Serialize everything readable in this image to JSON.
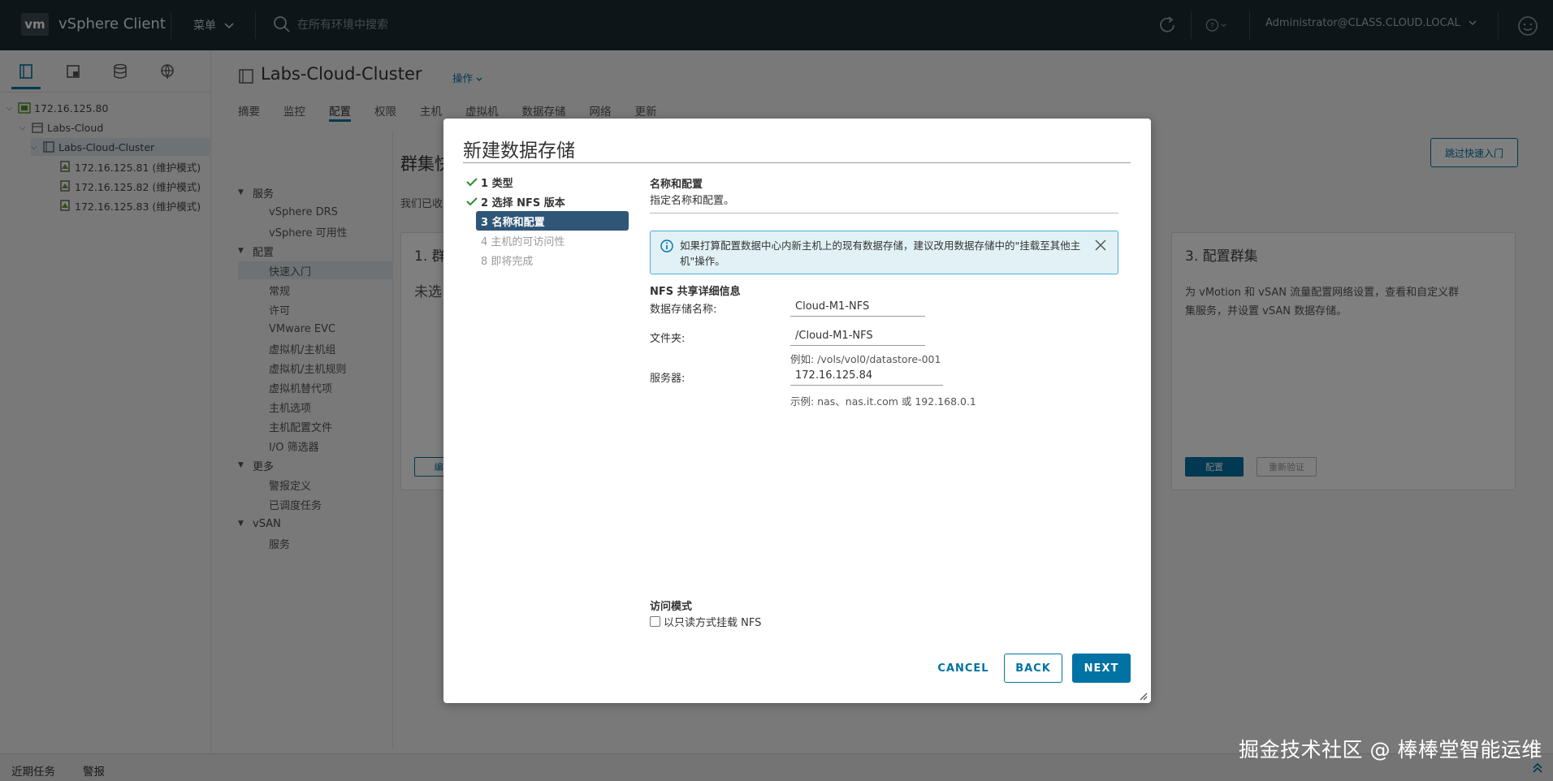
{
  "header": {
    "logo": "vm",
    "app_title": "vSphere Client",
    "menu_label": "菜单",
    "search_placeholder": "在所有环境中搜索",
    "user": "Administrator@CLASS.CLOUD.LOCAL"
  },
  "navigator": {
    "tree": [
      {
        "label": "172.16.125.80",
        "level": 0,
        "expanded": true,
        "icon": "vcenter-icon"
      },
      {
        "label": "Labs-Cloud",
        "level": 1,
        "expanded": true,
        "icon": "datacenter-icon"
      },
      {
        "label": "Labs-Cloud-Cluster",
        "level": 2,
        "expanded": true,
        "icon": "cluster-icon",
        "selected": true
      },
      {
        "label": "172.16.125.81 (维护模式)",
        "level": 3,
        "icon": "host-maintenance-icon"
      },
      {
        "label": "172.16.125.82 (维护模式)",
        "level": 3,
        "icon": "host-maintenance-icon"
      },
      {
        "label": "172.16.125.83 (维护模式)",
        "level": 3,
        "icon": "host-maintenance-icon"
      }
    ]
  },
  "main": {
    "object_title": "Labs-Cloud-Cluster",
    "actions_label": "操作",
    "tabs": [
      "摘要",
      "监控",
      "配置",
      "权限",
      "主机",
      "虚拟机",
      "数据存储",
      "网络",
      "更新"
    ],
    "active_tab": "配置",
    "section_menu": [
      {
        "label": "服务",
        "group": true
      },
      {
        "label": "vSphere DRS"
      },
      {
        "label": "vSphere 可用性"
      },
      {
        "label": "配置",
        "group": true
      },
      {
        "label": "快速入门",
        "selected": true
      },
      {
        "label": "常规"
      },
      {
        "label": "许可"
      },
      {
        "label": "VMware EVC"
      },
      {
        "label": "虚拟机/主机组"
      },
      {
        "label": "虚拟机/主机规则"
      },
      {
        "label": "虚拟机替代项"
      },
      {
        "label": "主机选项"
      },
      {
        "label": "主机配置文件"
      },
      {
        "label": "I/O 筛选器"
      },
      {
        "label": "更多",
        "group": true
      },
      {
        "label": "警报定义"
      },
      {
        "label": "已调度任务"
      },
      {
        "label": "vSAN",
        "group": true
      },
      {
        "label": "服务"
      }
    ],
    "background_heading": "群集快",
    "background_sub": "我们已收",
    "skip_button": "跳过快速入门",
    "card1_title": "1. 群",
    "card1_text": "未选",
    "card1_btn": "编",
    "card3": {
      "title": "3. 配置群集",
      "text": "为 vMotion 和 vSAN 流量配置网络设置，查看和自定义群集服务，并设置 vSAN 数据存储。",
      "configure_btn": "配置",
      "revalidate_btn": "重新验证"
    }
  },
  "modal": {
    "title": "新建数据存储",
    "steps": [
      {
        "label": "1 类型",
        "state": "done"
      },
      {
        "label": "2 选择 NFS 版本",
        "state": "done"
      },
      {
        "label": "3 名称和配置",
        "state": "current"
      },
      {
        "label": "4 主机的可访问性",
        "state": "pending"
      },
      {
        "label": "8 即将完成",
        "state": "pending"
      }
    ],
    "panel_title": "名称和配置",
    "panel_subtitle": "指定名称和配置。",
    "alert_text": "如果打算配置数据中心内新主机上的现有数据存储，建议改用数据存储中的\"挂载至其他主机\"操作。",
    "nfs_section": "NFS 共享详细信息",
    "fields": {
      "name_label": "数据存储名称:",
      "name_value": "Cloud-M1-NFS",
      "folder_label": "文件夹:",
      "folder_value": "/Cloud-M1-NFS",
      "folder_hint": "例如: /vols/vol0/datastore-001",
      "server_label": "服务器:",
      "server_value": "172.16.125.84",
      "server_hint": "示例: nas、nas.it.com 或 192.168.0.1"
    },
    "access_section": "访问模式",
    "readonly_label": "以只读方式挂载 NFS",
    "buttons": {
      "cancel": "CANCEL",
      "back": "BACK",
      "next": "NEXT"
    }
  },
  "bottombar": {
    "recent_tasks": "近期任务",
    "alarms": "警报"
  },
  "watermark": "掘金技术社区 @ 棒棒堂智能运维",
  "colors": {
    "header_bg": "#1b2a32",
    "accent": "#0072a3",
    "current_step": "#2f5677",
    "alert_bg": "#e1f1f6",
    "check": "#2e8c2e"
  }
}
